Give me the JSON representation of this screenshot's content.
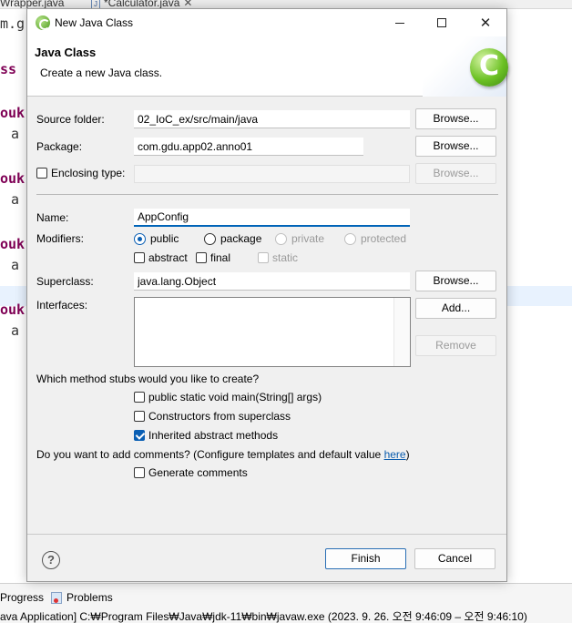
{
  "ide": {
    "tabs": [
      {
        "label": "Wrapper.java"
      },
      {
        "label": "*Calculator.java",
        "icon": "J"
      }
    ],
    "tab_close": "✕",
    "code_lines": [
      {
        "keyword": "",
        "text": "m.g"
      },
      {
        "keyword": "ss",
        "text": ""
      },
      {
        "keyword": "ouk",
        "text": ""
      },
      {
        "keyword": "",
        "text": "a"
      },
      {
        "keyword": "ouk",
        "text": ""
      },
      {
        "keyword": "",
        "text": "a"
      },
      {
        "keyword": "ouk",
        "text": ""
      },
      {
        "keyword": "",
        "text": "a"
      },
      {
        "keyword": "ouk",
        "text": ""
      },
      {
        "keyword": "",
        "text": "a"
      }
    ],
    "bottom_tabs": [
      {
        "label": "Progress"
      },
      {
        "label": "Problems"
      }
    ],
    "console_text": "ava Application] C:₩Program Files₩Java₩jdk-11₩bin₩javaw.exe  (2023. 9. 26. 오전 9:46:09 – 오전 9:46:10)"
  },
  "dialog": {
    "title": "New Java Class",
    "header": {
      "title": "Java Class",
      "description": "Create a new Java class.",
      "graphic_letter": "C"
    },
    "source_folder": {
      "label": "Source folder:",
      "value": "02_IoC_ex/src/main/java",
      "browse_label": "Browse..."
    },
    "package": {
      "label": "Package:",
      "value": "com.gdu.app02.anno01",
      "browse_label": "Browse..."
    },
    "enclosing_type": {
      "label": "Enclosing type:",
      "value": "",
      "checked": false,
      "browse_label": "Browse..."
    },
    "name": {
      "label": "Name:",
      "value": "AppConfig"
    },
    "modifiers": {
      "label": "Modifiers:",
      "access": [
        {
          "label": "public",
          "selected": true,
          "enabled": true
        },
        {
          "label": "package",
          "selected": false,
          "enabled": true
        },
        {
          "label": "private",
          "selected": false,
          "enabled": false
        },
        {
          "label": "protected",
          "selected": false,
          "enabled": false
        }
      ],
      "flags": [
        {
          "label": "abstract",
          "checked": false,
          "enabled": true
        },
        {
          "label": "final",
          "checked": false,
          "enabled": true
        },
        {
          "label": "static",
          "checked": false,
          "enabled": false
        }
      ]
    },
    "superclass": {
      "label": "Superclass:",
      "value": "java.lang.Object",
      "browse_label": "Browse..."
    },
    "interfaces": {
      "label": "Interfaces:",
      "items": [],
      "add_label": "Add...",
      "remove_label": "Remove"
    },
    "stubs": {
      "question": "Which method stubs would you like to create?",
      "options": [
        {
          "label": "public static void main(String[] args)",
          "checked": false
        },
        {
          "label": "Constructors from superclass",
          "checked": false
        },
        {
          "label": "Inherited abstract methods",
          "checked": true
        }
      ]
    },
    "comments": {
      "question_prefix": "Do you want to add comments? (Configure templates and default value ",
      "link_text": "here",
      "question_suffix": ")",
      "option": {
        "label": "Generate comments",
        "checked": false
      }
    },
    "footer": {
      "finish_label": "Finish",
      "cancel_label": "Cancel",
      "help_symbol": "?"
    },
    "window_controls": {
      "close_symbol": "✕"
    }
  }
}
